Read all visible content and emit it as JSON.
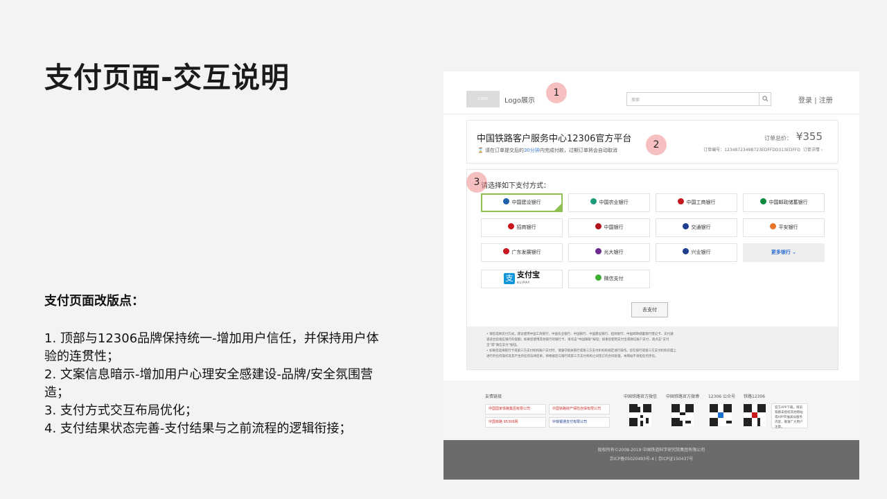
{
  "slide": {
    "title": "支付页面-交互说明",
    "notes_heading": "支付页面改版点：",
    "notes": [
      "1. 顶部与12306品牌保持统一-增加用户信任，并保持用户体验的连贯性；",
      "2. 文案信息暗示-增加用户心理安全感建设-品牌/安全氛围营造；",
      "3. 支付方式交互布局优化；",
      "4. 支付结果状态完善-支付结果与之前流程的逻辑衔接；"
    ]
  },
  "mock": {
    "header": {
      "logo_placeholder": "LOGO",
      "logo_text": "Logo展示",
      "search_placeholder": "搜索",
      "login": "登录",
      "separator": "|",
      "register": "注册"
    },
    "badges": [
      "1",
      "2",
      "3"
    ],
    "order": {
      "title": "中国铁路客户服务中心12306官方平台",
      "tip_before": "请在订单提交后的",
      "tip_highlight": "30分钟",
      "tip_after": "内完成付款，过期订单将会自动取消",
      "total_label": "订单总价：",
      "total_value": "¥355",
      "order_no": "订单编号：1234872349B723EDFFDD313EDFFD",
      "detail_link": "订单详情 ›"
    },
    "payment": {
      "prompt": "请选择如下支付方式：",
      "banks": [
        {
          "label": "中国建设银行",
          "color": "#1f5fa8"
        },
        {
          "label": "中国农业银行",
          "color": "#1d9a7c"
        },
        {
          "label": "中国工商银行",
          "color": "#c8161d"
        },
        {
          "label": "中国邮政储蓄银行",
          "color": "#0d8a3e"
        },
        {
          "label": "招商银行",
          "color": "#c8161d"
        },
        {
          "label": "中国银行",
          "color": "#b0141a"
        },
        {
          "label": "交通银行",
          "color": "#1d3f8f"
        },
        {
          "label": "平安银行",
          "color": "#e8742a"
        },
        {
          "label": "广东发展银行",
          "color": "#c8161d"
        },
        {
          "label": "光大银行",
          "color": "#6a2c91"
        },
        {
          "label": "兴业银行",
          "color": "#1d3f8f"
        }
      ],
      "more_label": "更多银行 ⌄",
      "alipay_label": "支付宝",
      "alipay_sub": "ALIPAY",
      "wechat_label": "微信支付",
      "wechat_color": "#3cb034",
      "go_pay": "去支付",
      "notice": [
        "• 请您选择支付方式。建议使用中国工商银行、中国农业银行、中国银行、中国建设银行、招商银行、中国邮政储蓄银行借记卡、支付通",
        "  道适合您相应银行的提额；如果您使用其他银行的银行卡，请点击“中国银联”按钮；如果您使用支付宝或微信账户支付，请点击“支付",
        "  宝”或“微信支付”按钮。",
        "• 如果您选择银行卡或第三方支付机构账户支付时，请遵守相关银行或第三方支付机构的规定进行操作。您在银行或第三方支付机构页面上",
        "  进行的任何操作及其产生的任何法律后果，将根据您与银行或第三方支付机构之间签订的合同处理，本网站不承担任何责任。"
      ]
    },
    "links": {
      "label": "友情链接",
      "items": [
        "中国国家铁路集团有限公司",
        "中国铁路财产保险自保有限公司",
        "中国铁路 95306网",
        "中铁银通支付有限公司"
      ],
      "qr_labels": [
        "中国铁路官方微信",
        "中国铁路官方微博",
        "12306 公众号",
        "铁路12306"
      ],
      "app_note": "官方APP下载，目前铁路未授权其他网站或APP开展类似服务内容，敬请广大用户注意。"
    },
    "footer": {
      "line1": "版权所有©2008-2019   中国铁道科学研究院集团有限公司",
      "line2": "京ICP备05020493号-4   |   京ICP证150437号"
    }
  }
}
